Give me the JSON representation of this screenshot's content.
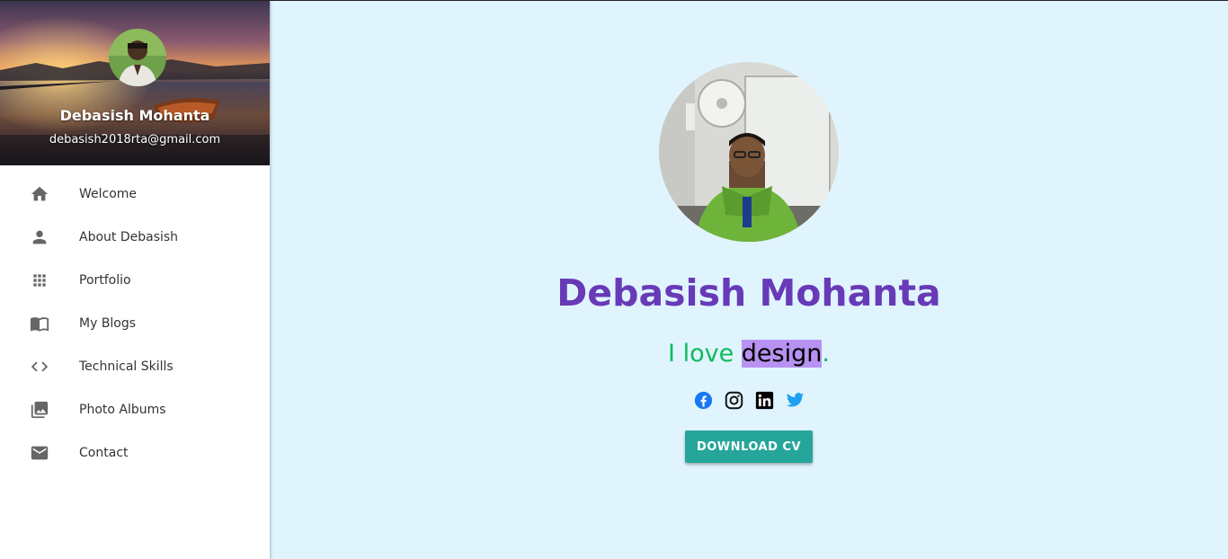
{
  "sidebar": {
    "profile": {
      "name": "Debasish Mohanta",
      "email": "debasish2018rta@gmail.com"
    },
    "items": [
      {
        "label": "Welcome",
        "icon": "home-icon"
      },
      {
        "label": "About Debasish",
        "icon": "person-icon"
      },
      {
        "label": "Portfolio",
        "icon": "apps-grid-icon"
      },
      {
        "label": "My Blogs",
        "icon": "book-icon"
      },
      {
        "label": "Technical Skills",
        "icon": "code-icon"
      },
      {
        "label": "Photo Albums",
        "icon": "photo-library-icon"
      },
      {
        "label": "Contact",
        "icon": "mail-icon"
      }
    ]
  },
  "hero": {
    "name": "Debasish Mohanta",
    "tagline_prefix": "I love ",
    "tagline_typed": "design",
    "tagline_suffix": ".",
    "cv_button": "DOWNLOAD CV",
    "socials": [
      "facebook-icon",
      "instagram-icon",
      "linkedin-icon",
      "twitter-icon"
    ]
  },
  "colors": {
    "page_bg": "#e0f4fe",
    "name": "#673ab7",
    "tagline": "#0dbb5c",
    "typed_highlight": "#b892f2",
    "button": "#26a69a",
    "facebook": "#1877f2",
    "twitter": "#1da1f2"
  }
}
